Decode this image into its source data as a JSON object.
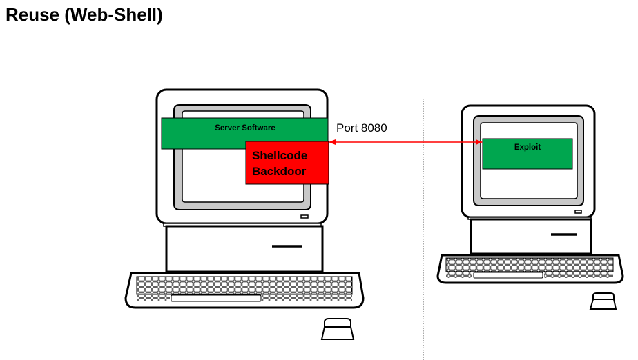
{
  "title": "Reuse (Web-Shell)",
  "server": {
    "software_label": "Server Software",
    "shellcode_line1": "Shellcode",
    "shellcode_line2": "Backdoor"
  },
  "client": {
    "exploit_label": "Exploit"
  },
  "connection": {
    "port_label": "Port 8080"
  },
  "colors": {
    "green_box": "#00a64f",
    "red_box": "#ff0000",
    "arrow": "#ff0000",
    "bezel": "#c8c8c8",
    "outline": "#000000"
  }
}
